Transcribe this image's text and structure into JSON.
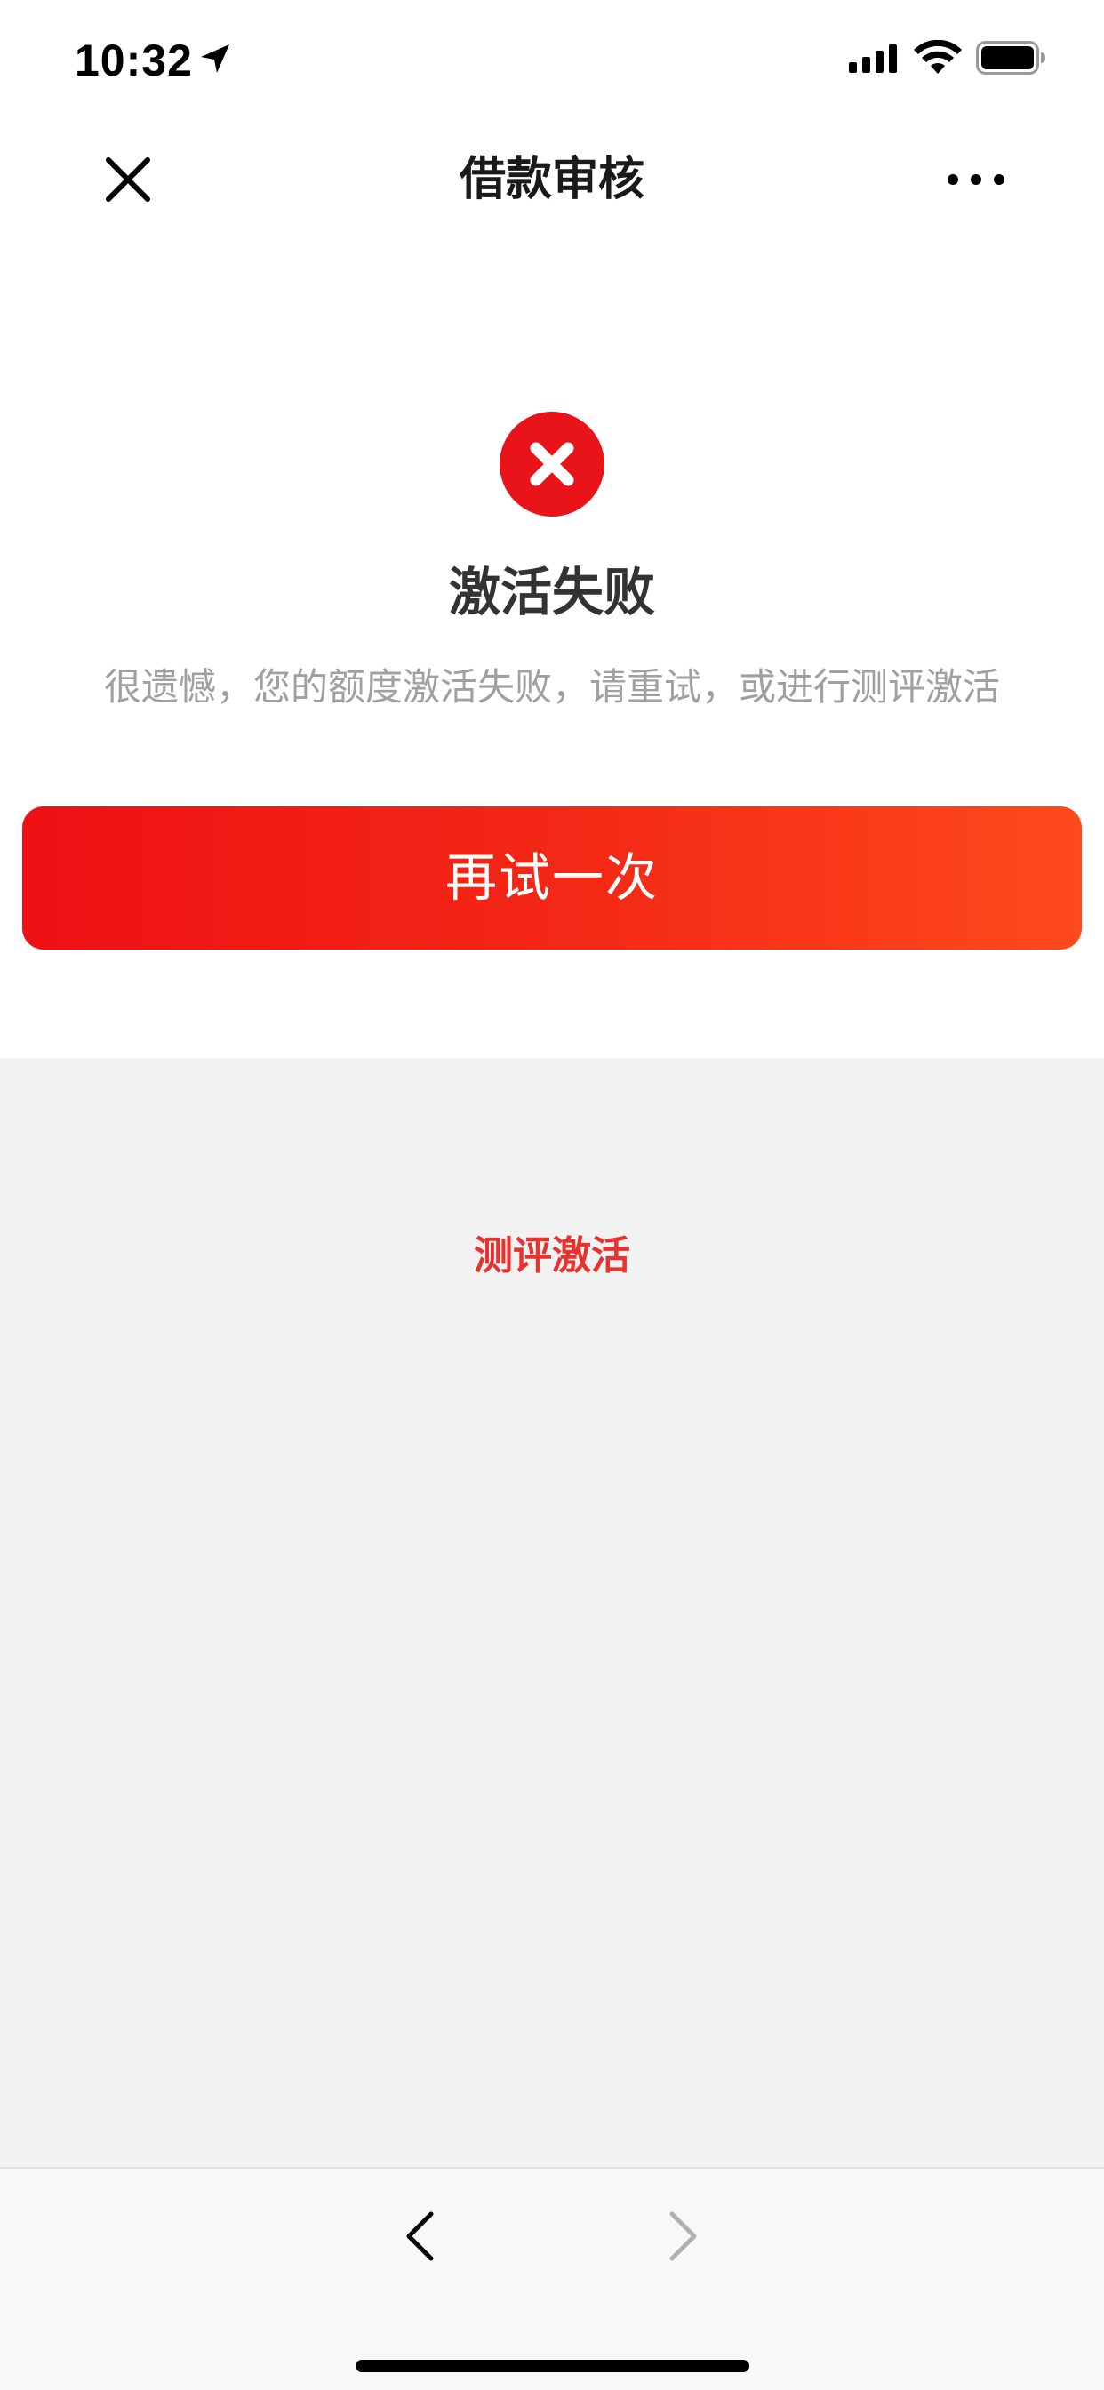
{
  "status_bar": {
    "time": "10:32"
  },
  "nav": {
    "title": "借款审核",
    "close_icon": "close-icon",
    "more_icon": "more-dots-icon"
  },
  "result": {
    "status": "error",
    "icon": "error-x-circle-icon",
    "title": "激活失败",
    "description": "很遗憾，您的额度激活失败，请重试，或进行测评激活"
  },
  "actions": {
    "retry_label": "再试一次",
    "assessment_link_label": "测评激活"
  },
  "toolbar": {
    "back_icon": "chevron-left-icon",
    "forward_icon": "chevron-right-icon",
    "forward_enabled": false
  },
  "colors": {
    "accent_red": "#ef1014",
    "accent_orange": "#ff4a1c",
    "link_red": "#e8322e",
    "error_icon_red": "#e9141a",
    "title_text": "#333333",
    "muted_text": "#a0a0a0",
    "gray_background": "#f2f2f2"
  }
}
